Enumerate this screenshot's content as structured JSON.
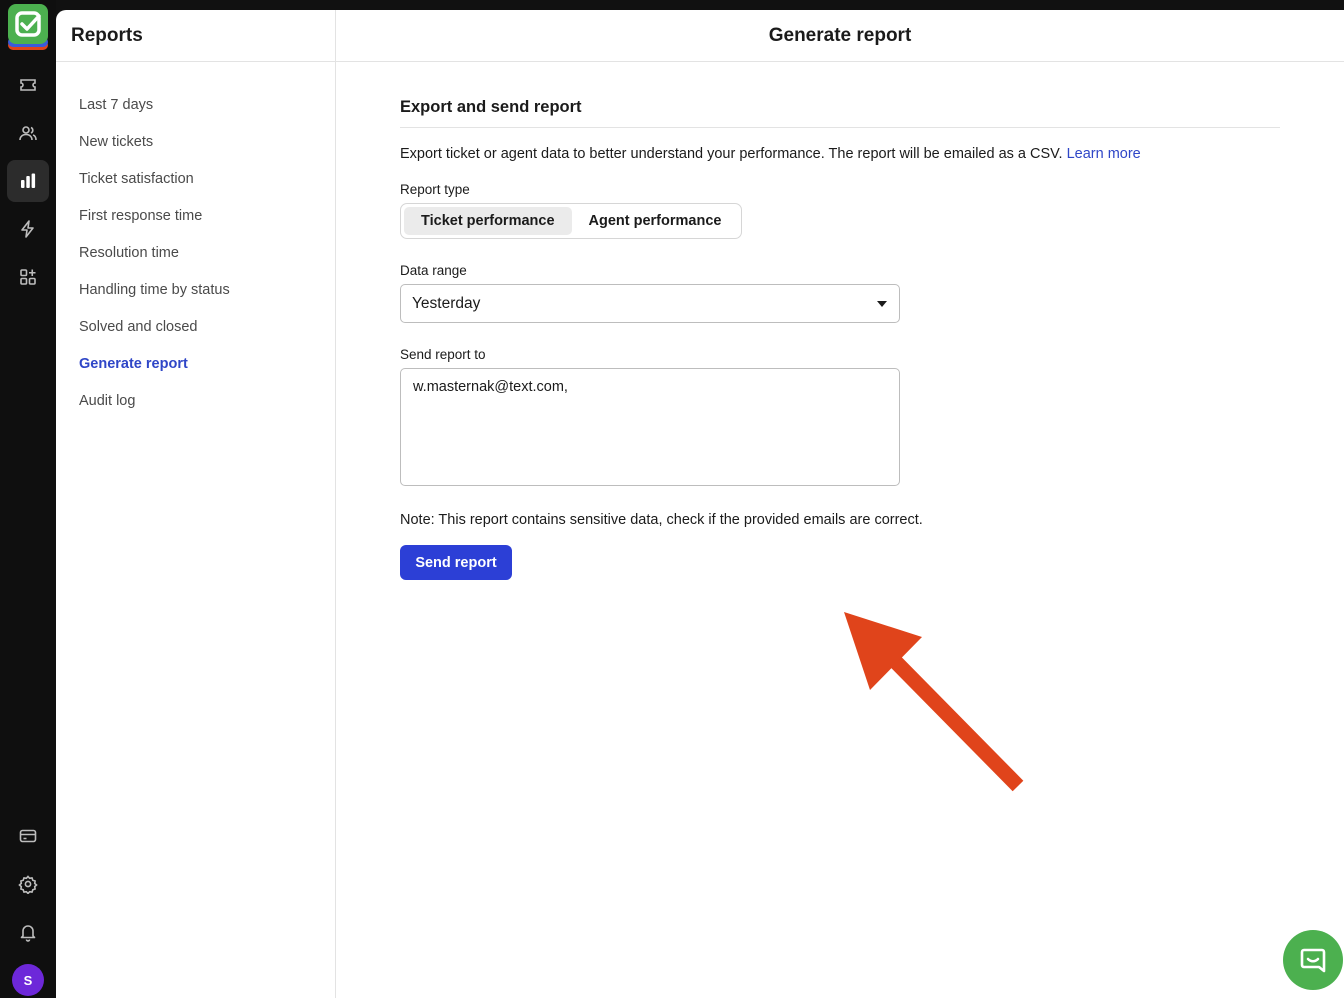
{
  "rail": {
    "icons": [
      "ticket-icon",
      "users-icon",
      "bar-chart-icon",
      "bolt-icon",
      "apps-icon",
      "billing-icon",
      "settings-icon",
      "bell-icon"
    ],
    "active_icon": "bar-chart-icon",
    "avatar_initial": "S",
    "logo_color": "#4cb04f"
  },
  "sidebar": {
    "title": "Reports",
    "items": [
      {
        "label": "Last 7 days"
      },
      {
        "label": "New tickets"
      },
      {
        "label": "Ticket satisfaction"
      },
      {
        "label": "First response time"
      },
      {
        "label": "Resolution time"
      },
      {
        "label": "Handling time by status"
      },
      {
        "label": "Solved and closed"
      },
      {
        "label": "Generate report"
      },
      {
        "label": "Audit log"
      }
    ],
    "active_index": 7
  },
  "main": {
    "title": "Generate report",
    "section_title": "Export and send report",
    "description": "Export ticket or agent data to better understand your performance. The report will be emailed as a CSV.",
    "learn_more": "Learn more",
    "report_type": {
      "label": "Report type",
      "options": [
        "Ticket performance",
        "Agent performance"
      ],
      "selected": "Ticket performance"
    },
    "data_range": {
      "label": "Data range",
      "value": "Yesterday"
    },
    "send_to": {
      "label": "Send report to",
      "value": "w.masternak@text.com,"
    },
    "note": "Note: This report contains sensitive data, check if the provided emails are correct.",
    "send_button": "Send report"
  },
  "colors": {
    "accent": "#2c3fd6",
    "link": "#2f46c7",
    "annotation_arrow": "#e0441b",
    "chat_bubble": "#4cb04f"
  }
}
